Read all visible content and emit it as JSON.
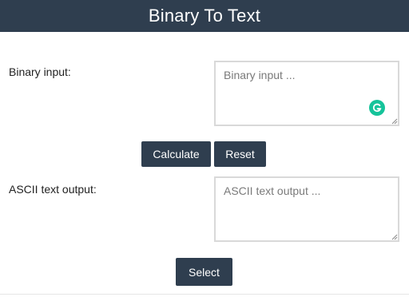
{
  "header": {
    "title": "Binary To Text"
  },
  "binary_input": {
    "label": "Binary input:",
    "placeholder": "Binary input ...",
    "value": ""
  },
  "buttons": {
    "calculate": "Calculate",
    "reset": "Reset",
    "select": "Select"
  },
  "ascii_output": {
    "label": "ASCII text output:",
    "placeholder": "ASCII text output ...",
    "value": ""
  },
  "colors": {
    "header_bg": "#2f3e4f",
    "button_bg": "#2f3e4f",
    "grammarly": "#15c39a"
  },
  "icons": {
    "grammarly": "grammarly-g-icon",
    "resize": "resize-handle-icon"
  }
}
